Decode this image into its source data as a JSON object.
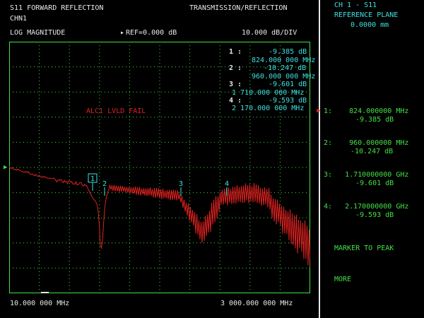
{
  "header": {
    "title": "S11 FORWARD REFLECTION",
    "channel": "CHN1",
    "mode": "TRANSMISSION/REFLECTION",
    "format": "LOG MAGNITUDE",
    "reference": "REF=0.000 dB",
    "scale": "10.000 dB/DIV"
  },
  "markers_readout": [
    {
      "num": "1 :",
      "value": "-9.385 dB",
      "freq": "824.000 000 MHz"
    },
    {
      "num": "2 :",
      "value": "-10.247 dB",
      "freq": "960.000 000 MHz"
    },
    {
      "num": "3 :",
      "value": "-9.601 dB",
      "freq": "1 710.000 000 MHz"
    },
    {
      "num": "4 :",
      "value": "-9.593 dB",
      "freq": "2 170.000 000 MHz"
    }
  ],
  "warning": "ALC1 LVLD FAIL",
  "axis": {
    "start": "10.000 000 MHz",
    "stop": "3 000.000 000 MHz"
  },
  "trace_marker_labels": [
    "1",
    "2",
    "3",
    "4"
  ],
  "sidebar": {
    "channel": "CH 1 - S11",
    "ref_plane_label": "REFERENCE PLANE",
    "ref_plane_value": "0.0000 mm",
    "softkeys": [
      {
        "line1": "1:    824.000000 MHz",
        "line2": "-9.385 dB"
      },
      {
        "line1": "2:    960.000000 MHz",
        "line2": "-10.247 dB"
      },
      {
        "line1": "3:   1.710000000 GHz",
        "line2": "-9.601 dB"
      },
      {
        "line1": "4:   2.170000000 GHz",
        "line2": "-9.593 dB"
      }
    ],
    "marker_to_peak": "MARKER TO PEAK",
    "more": "MORE"
  },
  "colors": {
    "background": "#000000",
    "text": "#e8e8e8",
    "cyan": "#3ee0e0",
    "grid": "#44e044",
    "trace": "#e02020"
  }
}
